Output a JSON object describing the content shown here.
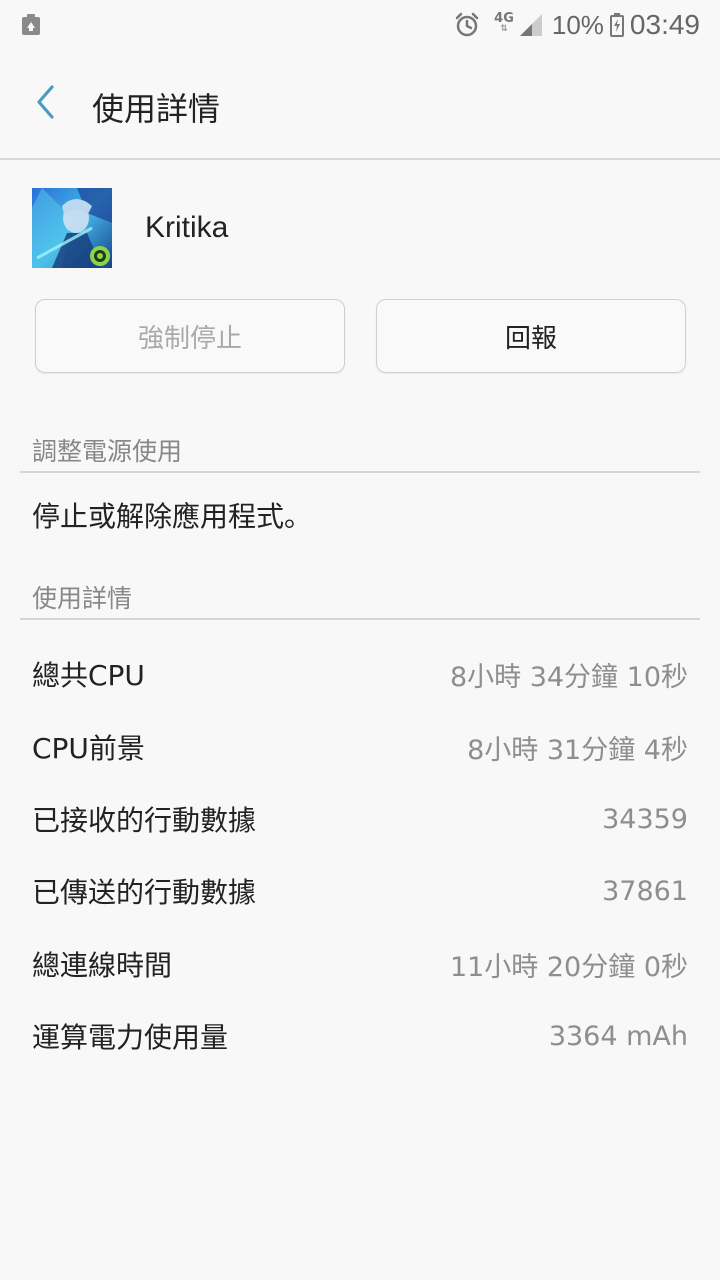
{
  "status_bar": {
    "network": "4G",
    "battery_percent": "10%",
    "time": "03:49",
    "icons": [
      "recycle-icon",
      "alarm-icon",
      "signal-icon",
      "battery-charging-icon"
    ]
  },
  "header": {
    "title": "使用詳情",
    "back_icon": "chevron-left-icon"
  },
  "app": {
    "name": "Kritika"
  },
  "buttons": {
    "force_stop": "強制停止",
    "report": "回報"
  },
  "power_section": {
    "header": "調整電源使用",
    "description": "停止或解除應用程式。"
  },
  "details_section": {
    "header": "使用詳情",
    "rows": [
      {
        "label": "總共CPU",
        "value": "8小時 34分鐘 10秒"
      },
      {
        "label": "CPU前景",
        "value": "8小時 31分鐘 4秒"
      },
      {
        "label": "已接收的行動數據",
        "value": "34359"
      },
      {
        "label": "已傳送的行動數據",
        "value": "37861"
      },
      {
        "label": "總連線時間",
        "value": "11小時 20分鐘 0秒"
      },
      {
        "label": "運算電力使用量",
        "value": "3364 mAh"
      }
    ]
  },
  "colors": {
    "accent": "#4a9bc4",
    "background": "#f8f8f8",
    "secondary_text": "#8e8e8e"
  }
}
